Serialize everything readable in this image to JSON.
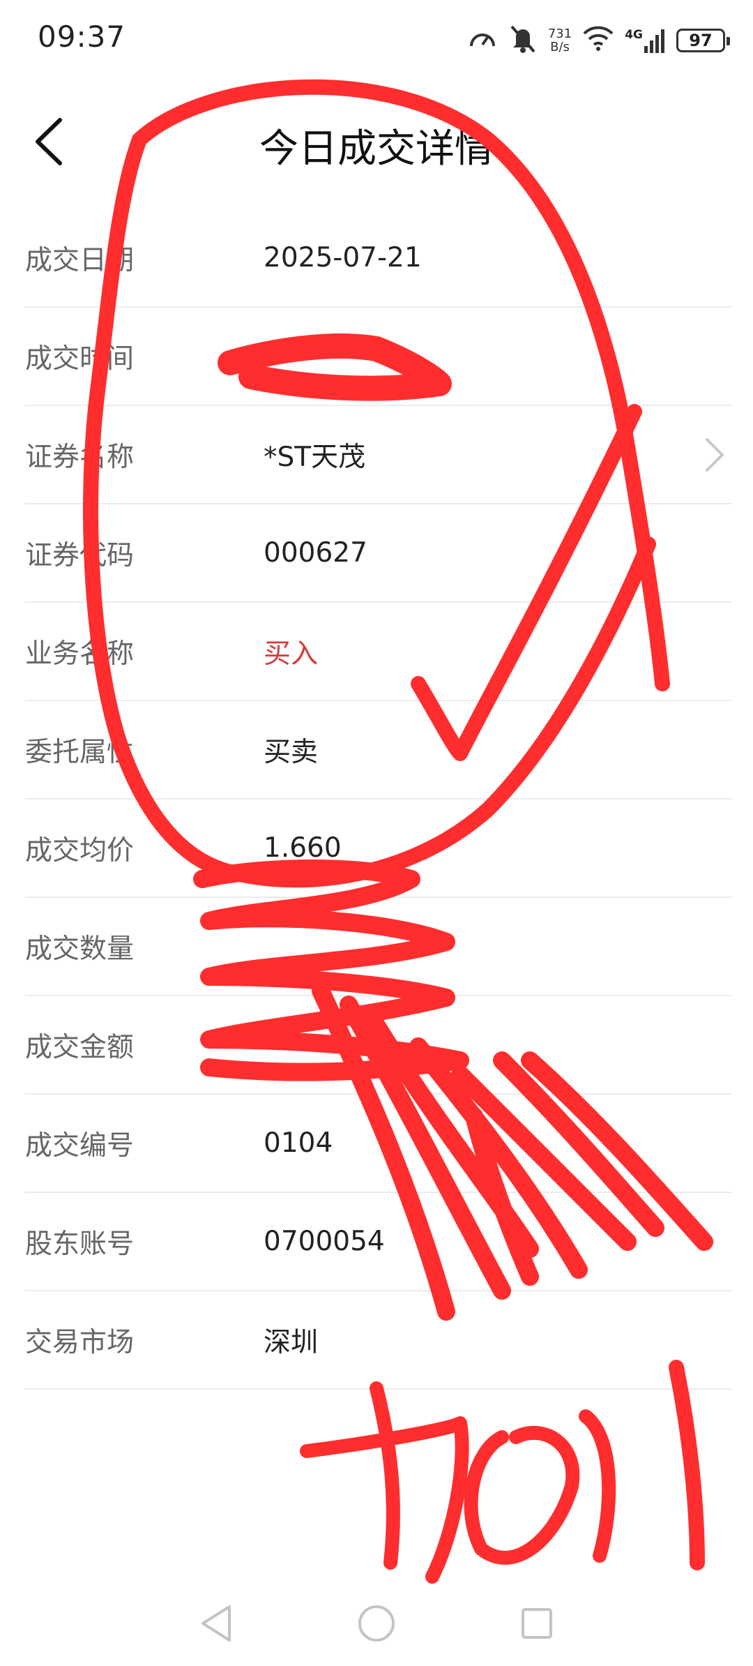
{
  "status_bar": {
    "time": "09:37",
    "net_speed_value": "731",
    "net_speed_unit": "B/s",
    "network_type": "4G",
    "battery": "97"
  },
  "header": {
    "title": "今日成交详情"
  },
  "details": [
    {
      "label": "成交日期",
      "value": "2025-07-21"
    },
    {
      "label": "成交时间",
      "value": ""
    },
    {
      "label": "证券名称",
      "value": "*ST天茂"
    },
    {
      "label": "证券代码",
      "value": "000627"
    },
    {
      "label": "业务名称",
      "value": "买入"
    },
    {
      "label": "委托属性",
      "value": "买卖"
    },
    {
      "label": "成交均价",
      "value": "1.660"
    },
    {
      "label": "成交数量",
      "value": ""
    },
    {
      "label": "成交金额",
      "value": ""
    },
    {
      "label": "成交编号",
      "value": "0104"
    },
    {
      "label": "股东账号",
      "value": "0700054"
    },
    {
      "label": "交易市场",
      "value": "深圳"
    }
  ],
  "annotation": {
    "handwritten_text": "加1"
  },
  "colors": {
    "accent_red": "#d93a3a",
    "scribble_red": "#ff2d2d"
  }
}
